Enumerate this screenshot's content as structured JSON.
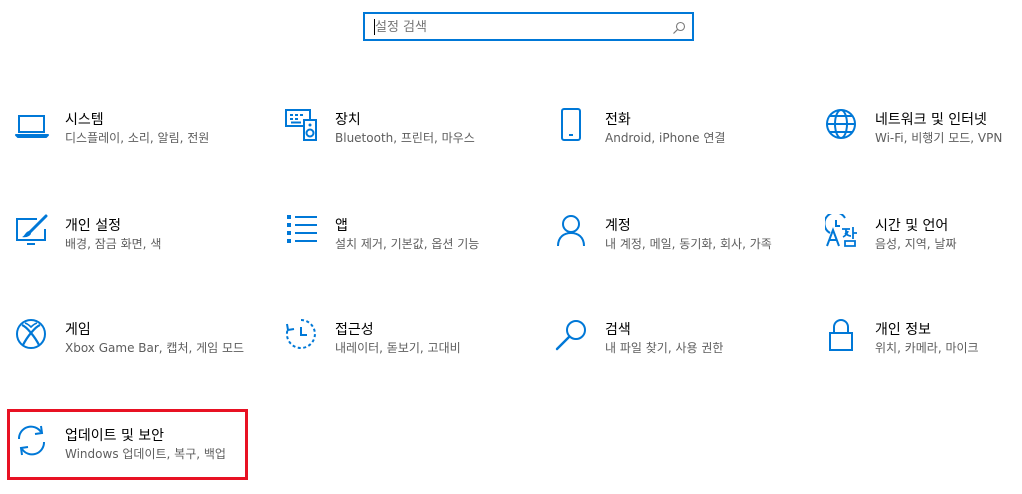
{
  "search": {
    "placeholder": "설정 검색",
    "value": ""
  },
  "accent_color": "#0078d7",
  "highlight_color": "#e81123",
  "tiles": [
    {
      "icon": "laptop-icon",
      "title": "시스템",
      "desc": "디스플레이, 소리, 알림, 전원"
    },
    {
      "icon": "devices-icon",
      "title": "장치",
      "desc": "Bluetooth, 프린터, 마우스"
    },
    {
      "icon": "phone-icon",
      "title": "전화",
      "desc": "Android, iPhone 연결"
    },
    {
      "icon": "globe-icon",
      "title": "네트워크 및 인터넷",
      "desc": "Wi-Fi, 비행기 모드, VPN"
    },
    {
      "icon": "personalization-icon",
      "title": "개인 설정",
      "desc": "배경, 잠금 화면, 색"
    },
    {
      "icon": "apps-icon",
      "title": "앱",
      "desc": "설치 제거, 기본값, 옵션 기능"
    },
    {
      "icon": "person-icon",
      "title": "계정",
      "desc": "내 계정, 메일, 동기화, 회사, 가족"
    },
    {
      "icon": "time-language-icon",
      "title": "시간 및 언어",
      "desc": "음성, 지역, 날짜"
    },
    {
      "icon": "xbox-icon",
      "title": "게임",
      "desc": "Xbox Game Bar, 캡처, 게임 모드"
    },
    {
      "icon": "ease-of-access-icon",
      "title": "접근성",
      "desc": "내레이터, 돋보기, 고대비"
    },
    {
      "icon": "search-icon",
      "title": "검색",
      "desc": "내 파일 찾기, 사용 권한"
    },
    {
      "icon": "lock-icon",
      "title": "개인 정보",
      "desc": "위치, 카메라, 마이크"
    },
    {
      "icon": "sync-icon",
      "title": "업데이트 및 보안",
      "desc": "Windows 업데이트, 복구, 백업"
    }
  ]
}
